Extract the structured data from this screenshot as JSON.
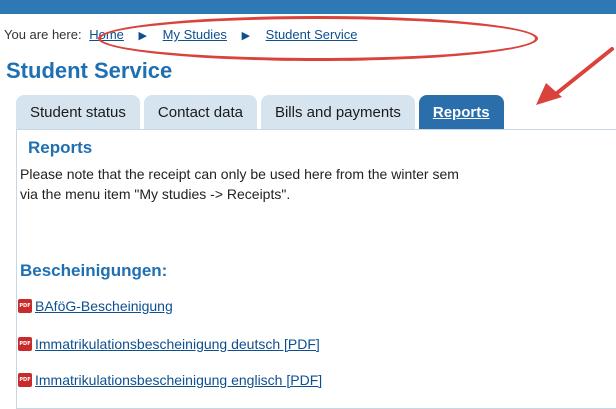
{
  "breadcrumb": {
    "prefix": "You are here:",
    "items": [
      "Home",
      "My Studies",
      "Student Service"
    ],
    "separator": "▶"
  },
  "page_title": "Student Service",
  "tabs": [
    {
      "label": "Student status"
    },
    {
      "label": "Contact data"
    },
    {
      "label": "Bills and payments"
    },
    {
      "label": "Reports",
      "active": true
    }
  ],
  "reports": {
    "title": "Reports",
    "note_line1": "Please note that the receipt can only be used here from the winter sem",
    "note_line2": "via the menu item \"My studies -> Receipts\"."
  },
  "certificates": {
    "heading": "Bescheinigungen:",
    "links": [
      "BAföG-Bescheinigung",
      "Immatrikulationsbescheinigung deutsch [PDF]",
      "Immatrikulationsbescheinigung englisch [PDF]"
    ]
  },
  "colors": {
    "accent": "#1f6fb3",
    "tab_active": "#2a6fab",
    "tab_inactive": "#d6e4ef",
    "annotation": "#d9433b",
    "pdf_icon": "#c92a2a"
  }
}
